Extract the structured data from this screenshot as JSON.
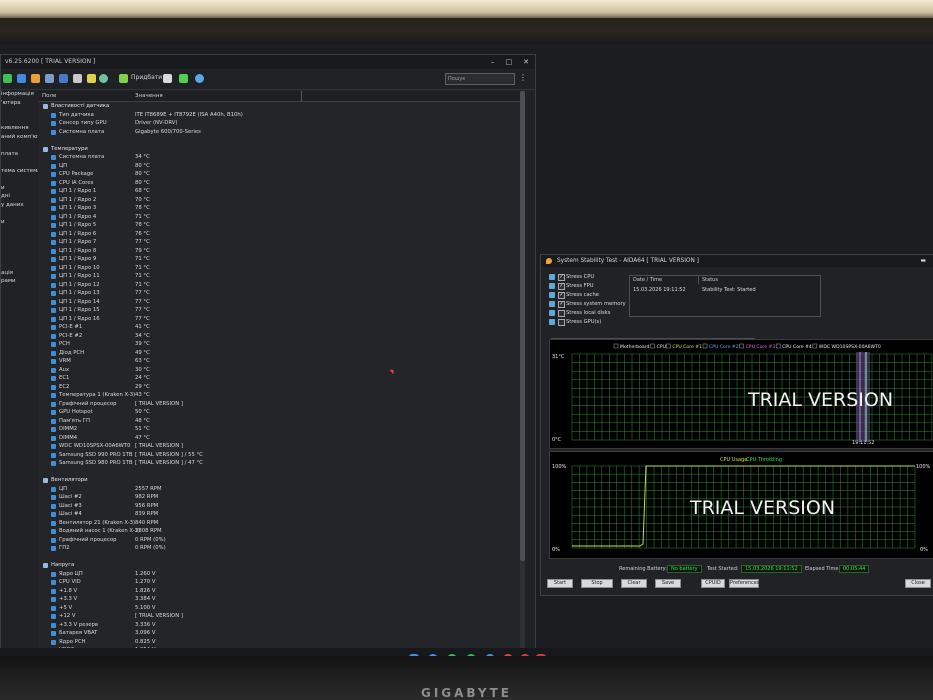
{
  "main_window": {
    "title": "v6.25.6200  [ TRIAL VERSION ]",
    "toolbar_label": "Придбати",
    "search_placeholder": "Пошук",
    "sidebar": [
      "інформація",
      "'ютера",
      "",
      "",
      "кивлення",
      "аний комп'юте",
      "",
      "плата",
      "",
      "тема система",
      "",
      "и",
      "дні",
      "у даних",
      "",
      "и",
      "",
      "",
      "",
      "",
      "",
      "ацiя",
      "рами"
    ],
    "columns": {
      "field": "Поле",
      "value": "Значення"
    },
    "rows": [
      {
        "f": "Властивості датчика",
        "v": "",
        "lvl": 0,
        "section": true
      },
      {
        "f": "Тип датчика",
        "v": "ITE IT8689E + IT8792E  (ISA A40h, B10h)",
        "lvl": 1
      },
      {
        "f": "Сенсор типу GPU",
        "v": "Driver  (NV-DRV)",
        "lvl": 1
      },
      {
        "f": "Системна плата",
        "v": "Gigabyte 600/700-Series",
        "lvl": 1
      },
      {
        "f": "",
        "v": "",
        "lvl": 0
      },
      {
        "f": "Температури",
        "v": "",
        "lvl": 0,
        "section": true
      },
      {
        "f": "Системна плата",
        "v": "34 °C",
        "lvl": 1
      },
      {
        "f": "ЦП",
        "v": "80 °C",
        "lvl": 1
      },
      {
        "f": "CPU Package",
        "v": "80 °C",
        "lvl": 1
      },
      {
        "f": "CPU IA Cores",
        "v": "80 °C",
        "lvl": 1
      },
      {
        "f": "ЦП 1 / Ядро 1",
        "v": "68 °C",
        "lvl": 1
      },
      {
        "f": "ЦП 1 / Ядро 2",
        "v": "70 °C",
        "lvl": 1
      },
      {
        "f": "ЦП 1 / Ядро 3",
        "v": "78 °C",
        "lvl": 1
      },
      {
        "f": "ЦП 1 / Ядро 4",
        "v": "71 °C",
        "lvl": 1
      },
      {
        "f": "ЦП 1 / Ядро 5",
        "v": "78 °C",
        "lvl": 1
      },
      {
        "f": "ЦП 1 / Ядро 6",
        "v": "76 °C",
        "lvl": 1
      },
      {
        "f": "ЦП 1 / Ядро 7",
        "v": "77 °C",
        "lvl": 1
      },
      {
        "f": "ЦП 1 / Ядро 8",
        "v": "79 °C",
        "lvl": 1
      },
      {
        "f": "ЦП 1 / Ядро 9",
        "v": "71 °C",
        "lvl": 1
      },
      {
        "f": "ЦП 1 / Ядро 10",
        "v": "71 °C",
        "lvl": 1
      },
      {
        "f": "ЦП 1 / Ядро 11",
        "v": "71 °C",
        "lvl": 1
      },
      {
        "f": "ЦП 1 / Ядро 12",
        "v": "71 °C",
        "lvl": 1
      },
      {
        "f": "ЦП 1 / Ядро 13",
        "v": "77 °C",
        "lvl": 1
      },
      {
        "f": "ЦП 1 / Ядро 14",
        "v": "77 °C",
        "lvl": 1
      },
      {
        "f": "ЦП 1 / Ядро 15",
        "v": "77 °C",
        "lvl": 1
      },
      {
        "f": "ЦП 1 / Ядро 16",
        "v": "77 °C",
        "lvl": 1
      },
      {
        "f": "PCI-E #1",
        "v": "41 °C",
        "lvl": 1
      },
      {
        "f": "PCI-E #2",
        "v": "34 °C",
        "lvl": 1
      },
      {
        "f": "PCH",
        "v": "39 °C",
        "lvl": 1
      },
      {
        "f": "Діод PCH",
        "v": "49 °C",
        "lvl": 1
      },
      {
        "f": "VRM",
        "v": "63 °C",
        "lvl": 1
      },
      {
        "f": "Aux",
        "v": "30 °C",
        "lvl": 1
      },
      {
        "f": "EC1",
        "v": "24 °C",
        "lvl": 1
      },
      {
        "f": "EC2",
        "v": "29 °C",
        "lvl": 1
      },
      {
        "f": "Температура 1 (Kraken X-3)",
        "v": "43 °C",
        "lvl": 1
      },
      {
        "f": "Графічний процесор",
        "v": "[ TRIAL VERSION ]",
        "lvl": 1
      },
      {
        "f": "GPU Hotspot",
        "v": "50 °C",
        "lvl": 1
      },
      {
        "f": "Пам'ять ГП",
        "v": "48 °C",
        "lvl": 1
      },
      {
        "f": "DIMM2",
        "v": "51 °C",
        "lvl": 1
      },
      {
        "f": "DIMM4",
        "v": "47 °C",
        "lvl": 1
      },
      {
        "f": "WDC WD10SPSX-00A6WT0",
        "v": "[ TRIAL VERSION ]",
        "lvl": 1
      },
      {
        "f": "Samsung SSD 990 PRO 1TB",
        "v": "[ TRIAL VERSION ] / 55 °C",
        "lvl": 1
      },
      {
        "f": "Samsung SSD 980 PRO 1TB",
        "v": "[ TRIAL VERSION ] / 47 °C",
        "lvl": 1
      },
      {
        "f": "",
        "v": "",
        "lvl": 0
      },
      {
        "f": "Вентилятори",
        "v": "",
        "lvl": 0,
        "section": true
      },
      {
        "f": "ЦП",
        "v": "2557 RPM",
        "lvl": 1
      },
      {
        "f": "Шасі #2",
        "v": "982 RPM",
        "lvl": 1
      },
      {
        "f": "Шасі #3",
        "v": "956 RPM",
        "lvl": 1
      },
      {
        "f": "Шасі #4",
        "v": "839 RPM",
        "lvl": 1
      },
      {
        "f": "Вентилятор 21 (Kraken X-3)",
        "v": "840 RPM",
        "lvl": 1
      },
      {
        "f": "Водяний насос 1 (Kraken X-3)",
        "v": "2808 RPM",
        "lvl": 1
      },
      {
        "f": "Графічний процесор",
        "v": "0 RPM  (0%)",
        "lvl": 1
      },
      {
        "f": "ГП2",
        "v": "0 RPM  (0%)",
        "lvl": 1
      },
      {
        "f": "",
        "v": "",
        "lvl": 0
      },
      {
        "f": "Напруга",
        "v": "",
        "lvl": 0,
        "section": true
      },
      {
        "f": "Ядро ЦП",
        "v": "1.260 V",
        "lvl": 1
      },
      {
        "f": "CPU VID",
        "v": "1.270 V",
        "lvl": 1
      },
      {
        "f": "+1.8 V",
        "v": "1.826 V",
        "lvl": 1
      },
      {
        "f": "+3.3 V",
        "v": "3.384 V",
        "lvl": 1
      },
      {
        "f": "+5 V",
        "v": "5.100 V",
        "lvl": 1
      },
      {
        "f": "+12 V",
        "v": "[ TRIAL VERSION ]",
        "lvl": 1
      },
      {
        "f": "+3.3 V резерв",
        "v": "3.336 V",
        "lvl": 1
      },
      {
        "f": "Батарея VBAT",
        "v": "3.096 V",
        "lvl": 1
      },
      {
        "f": "Ядро PCH",
        "v": "0.825 V",
        "lvl": 1
      },
      {
        "f": "VDD2",
        "v": "1.254 V",
        "lvl": 1
      },
      {
        "f": "VCCIN Aux",
        "v": "1.830 V",
        "lvl": 1
      }
    ]
  },
  "stability_window": {
    "title": "System Stability Test - AIDA64  [ TRIAL VERSION ]",
    "stress_items": [
      {
        "label": "Stress CPU",
        "checked": true
      },
      {
        "label": "Stress FPU",
        "checked": true
      },
      {
        "label": "Stress cache",
        "checked": true
      },
      {
        "label": "Stress system memory",
        "checked": true
      },
      {
        "label": "Stress local disks",
        "checked": false
      },
      {
        "label": "Stress GPU(s)",
        "checked": false
      }
    ],
    "status_headers": {
      "date": "Date / Time",
      "status": "Status"
    },
    "status_row": {
      "date": "15.03.2026 19:11:52",
      "status": "Stability Test: Started"
    },
    "tabs": [
      "Temperatures",
      "Cooling Fans",
      "Voltages",
      "Powers",
      "Clocks",
      "Unified",
      "Statistics"
    ],
    "chart1_legend": [
      "Motherboard",
      "CPU",
      "CPU Core #1",
      "CPU Core #2",
      "CPU Core #3",
      "CPU Core #4",
      "WDC WD10SPSX-00A6WT0"
    ],
    "chart1_ymax": "31°C",
    "chart1_ymin": "0°C",
    "chart1_time": "19:11:52",
    "watermark": "TRIAL VERSION",
    "chart2_legend": [
      "CPU Usage",
      "CPU Throttling"
    ],
    "chart2_ymax": "100%",
    "chart2_ymin": "0%",
    "chart2_ymax_right": "100%",
    "chart2_ymin_right": "0%",
    "remaining_battery_label": "Remaining Battery:",
    "remaining_battery": "No battery",
    "test_started_label": "Test Started:",
    "test_started": "15.03.2026 19:11:52",
    "elapsed_label": "Elapsed Time:",
    "elapsed": "00:05:44",
    "buttons": [
      "Start",
      "Stop",
      "Clear",
      "Save",
      "CPUID",
      "Preferences",
      "Close"
    ],
    "accent_green": "#21e34a"
  },
  "monitor_brand": "GIGABYTE"
}
